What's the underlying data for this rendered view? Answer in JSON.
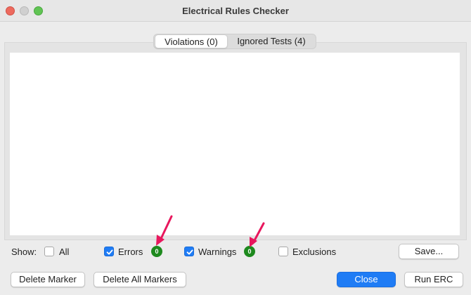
{
  "window": {
    "title": "Electrical Rules Checker",
    "controls": [
      "close-icon",
      "minimize-icon",
      "maximize-icon"
    ]
  },
  "tabs": [
    {
      "label": "Violations (0)",
      "active": true
    },
    {
      "label": "Ignored Tests (4)",
      "active": false
    }
  ],
  "violations_list": {
    "items": []
  },
  "filters": {
    "show_label": "Show:",
    "all": {
      "label": "All",
      "checked": false
    },
    "errors": {
      "label": "Errors",
      "checked": true,
      "count": "0"
    },
    "warnings": {
      "label": "Warnings",
      "checked": true,
      "count": "0"
    },
    "exclusions": {
      "label": "Exclusions",
      "checked": false
    }
  },
  "buttons": {
    "save": "Save...",
    "delete_marker": "Delete Marker",
    "delete_all_markers": "Delete All Markers",
    "close": "Close",
    "run_erc": "Run ERC"
  },
  "colors": {
    "accent": "#1f7cf5",
    "badge": "#1e8a1e",
    "annotation_arrow": "#e8175d"
  }
}
